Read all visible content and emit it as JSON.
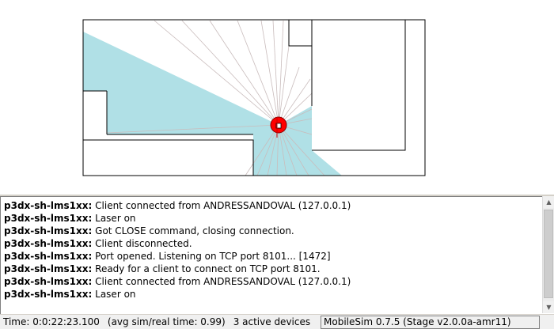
{
  "simulator": {
    "robot_color": "#ff0000",
    "laser_color": "#b0e0e6",
    "wall_color": "#000000"
  },
  "log": {
    "source": "p3dx-sh-lms1xx:",
    "lines": [
      "Client connected from ANDRESSANDOVAL (127.0.0.1)",
      "Laser on",
      "Got CLOSE command, closing connection.",
      "Client disconnected.",
      "Port opened. Listening on TCP port 8101... [1472]",
      "Ready for a client to connect on TCP port 8101.",
      "Client connected from ANDRESSANDOVAL (127.0.0.1)",
      "Laser on"
    ]
  },
  "status": {
    "time": "Time: 0:0:22:23.100",
    "avg": "(avg sim/real time: 0.99)",
    "devices": "3 active devices",
    "version": "MobileSim 0.7.5 (Stage v2.0.0a-amr11)"
  }
}
